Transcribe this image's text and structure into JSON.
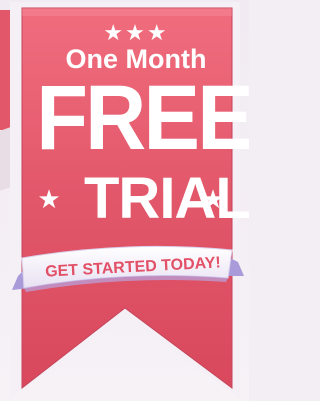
{
  "ribbon": {
    "stars": "★★★",
    "line1": "One Month",
    "line2": "FREE",
    "line3": "TRIAL",
    "side_star": "★",
    "cta": "GET STARTED TODAY!"
  },
  "colors": {
    "ribbon": "#e2576a",
    "ribbon_dark": "#c5455a",
    "banner_band": "#f3eef6",
    "band_shadow": "#a99ad9",
    "text": "#ffffff",
    "cta_text": "#e25067"
  },
  "icons": [
    "star-icon"
  ]
}
